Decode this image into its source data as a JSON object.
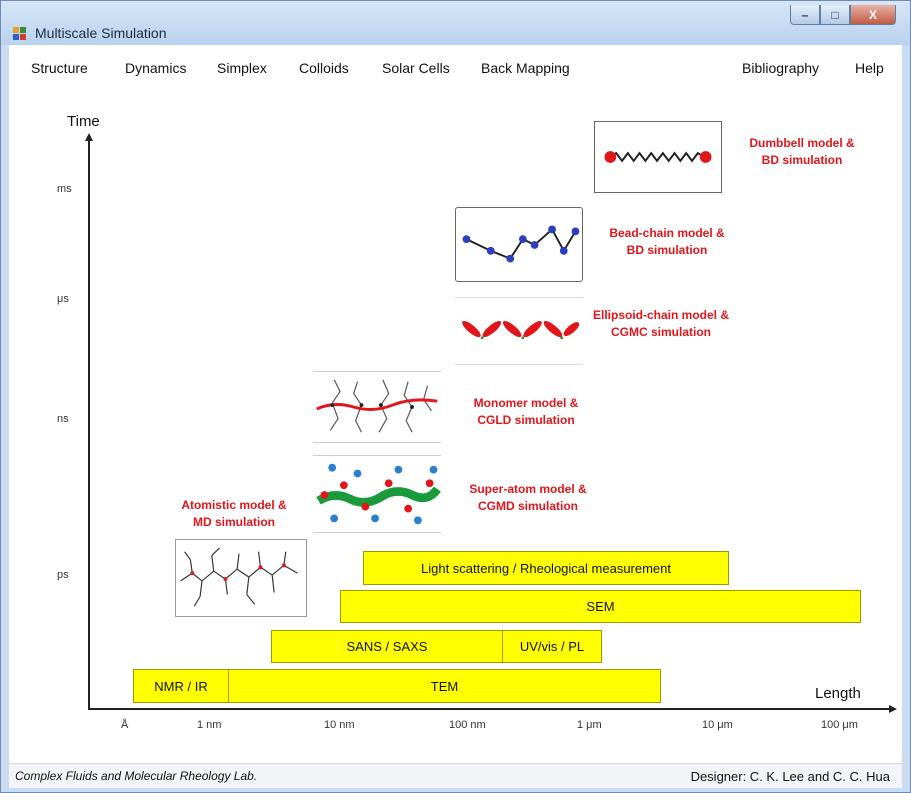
{
  "window": {
    "title": "Multiscale Simulation",
    "minimize": "–",
    "maximize": "□",
    "close": "X"
  },
  "menu": {
    "left": [
      "Structure",
      "Dynamics",
      "Simplex",
      "Colloids",
      "Solar Cells",
      "Back Mapping"
    ],
    "right": [
      "Bibliography",
      "Help"
    ]
  },
  "chart": {
    "y_title": "Time",
    "x_title": "Length",
    "y_ticks": [
      "ms",
      "μs",
      "ns",
      "ps"
    ],
    "x_ticks": [
      "Å",
      "1 nm",
      "10 nm",
      "100 nm",
      "1 μm",
      "10 μm",
      "100 μm"
    ]
  },
  "models": [
    {
      "label_line1": "Dumbbell model &",
      "label_line2": "BD simulation"
    },
    {
      "label_line1": "Bead-chain model &",
      "label_line2": "BD simulation"
    },
    {
      "label_line1": "Ellipsoid-chain model &",
      "label_line2": "CGMC simulation"
    },
    {
      "label_line1": "Monomer model &",
      "label_line2": "CGLD simulation"
    },
    {
      "label_line1": "Super-atom model &",
      "label_line2": "CGMD simulation"
    },
    {
      "label_line1": "Atomistic model &",
      "label_line2": "MD simulation"
    }
  ],
  "techniques": [
    "Light scattering / Rheological measurement",
    "SEM",
    "SANS / SAXS",
    "UV/vis / PL",
    "NMR / IR",
    "TEM"
  ],
  "colors": {
    "bar": "#ffff00",
    "label": "#e0161b",
    "bead": "#2b3fbf",
    "ellipsoid": "#e0161b"
  },
  "status": {
    "left": "Complex Fluids and Molecular Rheology Lab.",
    "right": "Designer: C. K. Lee and C. C. Hua"
  }
}
